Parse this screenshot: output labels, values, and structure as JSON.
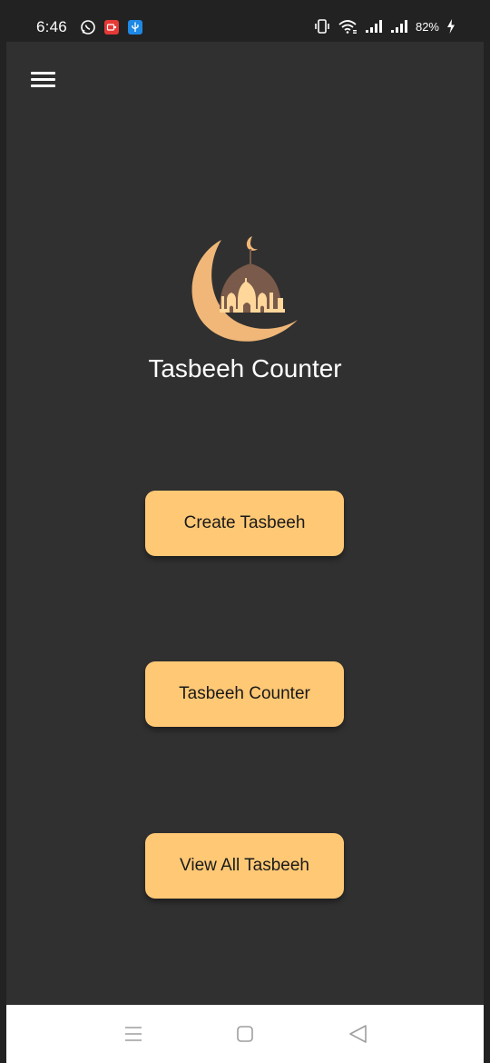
{
  "status_bar": {
    "time": "6:46",
    "battery": "82%",
    "icons": [
      "whatsapp-icon",
      "screen-recorder-icon",
      "usb-icon",
      "vibrate-icon",
      "wifi-icon",
      "signal-icon",
      "signal-icon",
      "charging-icon"
    ]
  },
  "app": {
    "menu_icon": "hamburger-menu-icon",
    "logo_icon": "mosque-crescent-logo",
    "title": "Tasbeeh Counter",
    "buttons": {
      "create": "Create Tasbeeh",
      "counter": "Tasbeeh Counter",
      "view_all": "View All Tasbeeh"
    }
  },
  "nav_bar": {
    "icons": [
      "recent-apps-icon",
      "home-icon",
      "back-icon"
    ]
  },
  "colors": {
    "background": "#303030",
    "button": "#ffc875",
    "button_text": "#1a1a1a",
    "title_text": "#ffffff",
    "logo_crescent": "#f0b778",
    "logo_dome": "#7a5a4a",
    "logo_building": "#ffd79b"
  }
}
